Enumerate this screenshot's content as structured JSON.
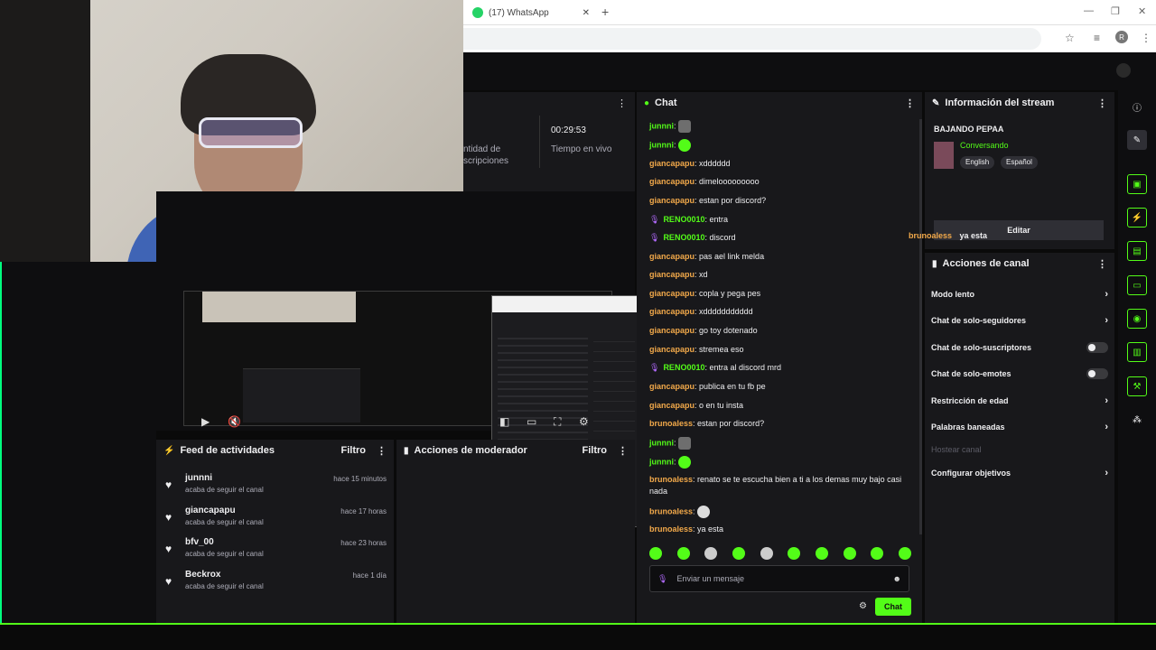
{
  "browser": {
    "tab_title": "(17) WhatsApp",
    "tab_close": "✕",
    "new_tab": "+",
    "profile_initial": "R"
  },
  "stats": {
    "subs_label_line1": "ntidad de",
    "subs_label_line2": "scripciones",
    "time_value": "00:29:53",
    "time_label": "Tiempo en vivo"
  },
  "feed": {
    "title": "Feed de actividades",
    "filter": "Filtro",
    "items": [
      {
        "user": "junnni",
        "sub": "acaba de seguir el canal",
        "time": "hace 15 minutos"
      },
      {
        "user": "giancapapu",
        "sub": "acaba de seguir el canal",
        "time": "hace 17 horas"
      },
      {
        "user": "bfv_00",
        "sub": "acaba de seguir el canal",
        "time": "hace 23 horas"
      },
      {
        "user": "Beckrox",
        "sub": "acaba de seguir el canal",
        "time": "hace 1 día"
      }
    ]
  },
  "modactions": {
    "title": "Acciones de moderador",
    "filter": "Filtro"
  },
  "chat": {
    "title": "Chat",
    "messages": [
      {
        "user": "junnni",
        "color": "green",
        "text": "",
        "emote": "img"
      },
      {
        "user": "junnni",
        "color": "green",
        "text": "",
        "emote": "green"
      },
      {
        "user": "giancapapu",
        "color": "orange",
        "text": "xdddddd"
      },
      {
        "user": "giancapapu",
        "color": "orange",
        "text": "dimelooooooooo"
      },
      {
        "user": "giancapapu",
        "color": "orange",
        "text": "estan por discord?"
      },
      {
        "user": "RENO0010",
        "color": "green",
        "mic": true,
        "text": "entra"
      },
      {
        "user": "RENO0010",
        "color": "green",
        "mic": true,
        "text": "discord"
      },
      {
        "user": "giancapapu",
        "color": "orange",
        "text": "pas ael link melda"
      },
      {
        "user": "giancapapu",
        "color": "orange",
        "text": "xd"
      },
      {
        "user": "giancapapu",
        "color": "orange",
        "text": "copla y pega pes"
      },
      {
        "user": "giancapapu",
        "color": "orange",
        "text": "xddddddddddd"
      },
      {
        "user": "giancapapu",
        "color": "orange",
        "text": "go toy dotenado"
      },
      {
        "user": "giancapapu",
        "color": "orange",
        "text": "stremea eso"
      },
      {
        "user": "RENO0010",
        "color": "green",
        "mic": true,
        "text": "entra al discord mrd"
      },
      {
        "user": "giancapapu",
        "color": "orange",
        "text": "publica en tu fb pe"
      },
      {
        "user": "giancapapu",
        "color": "orange",
        "text": "o en tu insta"
      },
      {
        "user": "brunoaless",
        "color": "orange",
        "text": "estan por discord?"
      },
      {
        "user": "junnni",
        "color": "green",
        "text": "",
        "emote": "img"
      },
      {
        "user": "junnni",
        "color": "green",
        "text": "",
        "emote": "green"
      },
      {
        "user": "brunoaless",
        "color": "orange",
        "text": "renato se te escucha bien a ti a los demas muy bajo casi nada"
      },
      {
        "user": "brunoaless",
        "color": "orange",
        "text": "",
        "emote": "face"
      },
      {
        "user": "brunoaless",
        "color": "orange",
        "text": "ya esta"
      }
    ],
    "placeholder": "Enviar un mensaje",
    "send_label": "Chat"
  },
  "streaminfo": {
    "header": "Información del stream",
    "title": "BAJANDO PEPAA",
    "category": "Conversando",
    "tags": [
      "English",
      "Español"
    ],
    "edit_label": "Editar"
  },
  "overlay": {
    "user": "brunoaless",
    "text": "ya esta"
  },
  "channelactions": {
    "header": "Acciones de canal",
    "items": [
      {
        "label": "Modo lento",
        "kind": "chevron"
      },
      {
        "label": "Chat de solo-seguidores",
        "kind": "chevron"
      },
      {
        "label": "Chat de solo-suscriptores",
        "kind": "toggle"
      },
      {
        "label": "Chat de solo-emotes",
        "kind": "toggle"
      },
      {
        "label": "Restricción de edad",
        "kind": "chevron"
      },
      {
        "label": "Palabras baneadas",
        "kind": "chevron"
      },
      {
        "label": "Hostear canal",
        "kind": "disabled"
      },
      {
        "label": "Configurar objetivos",
        "kind": "chevron"
      }
    ]
  },
  "colors": {
    "accent": "#53fc18",
    "username_orange": "#f2a94a",
    "panel_bg": "#18181b"
  }
}
